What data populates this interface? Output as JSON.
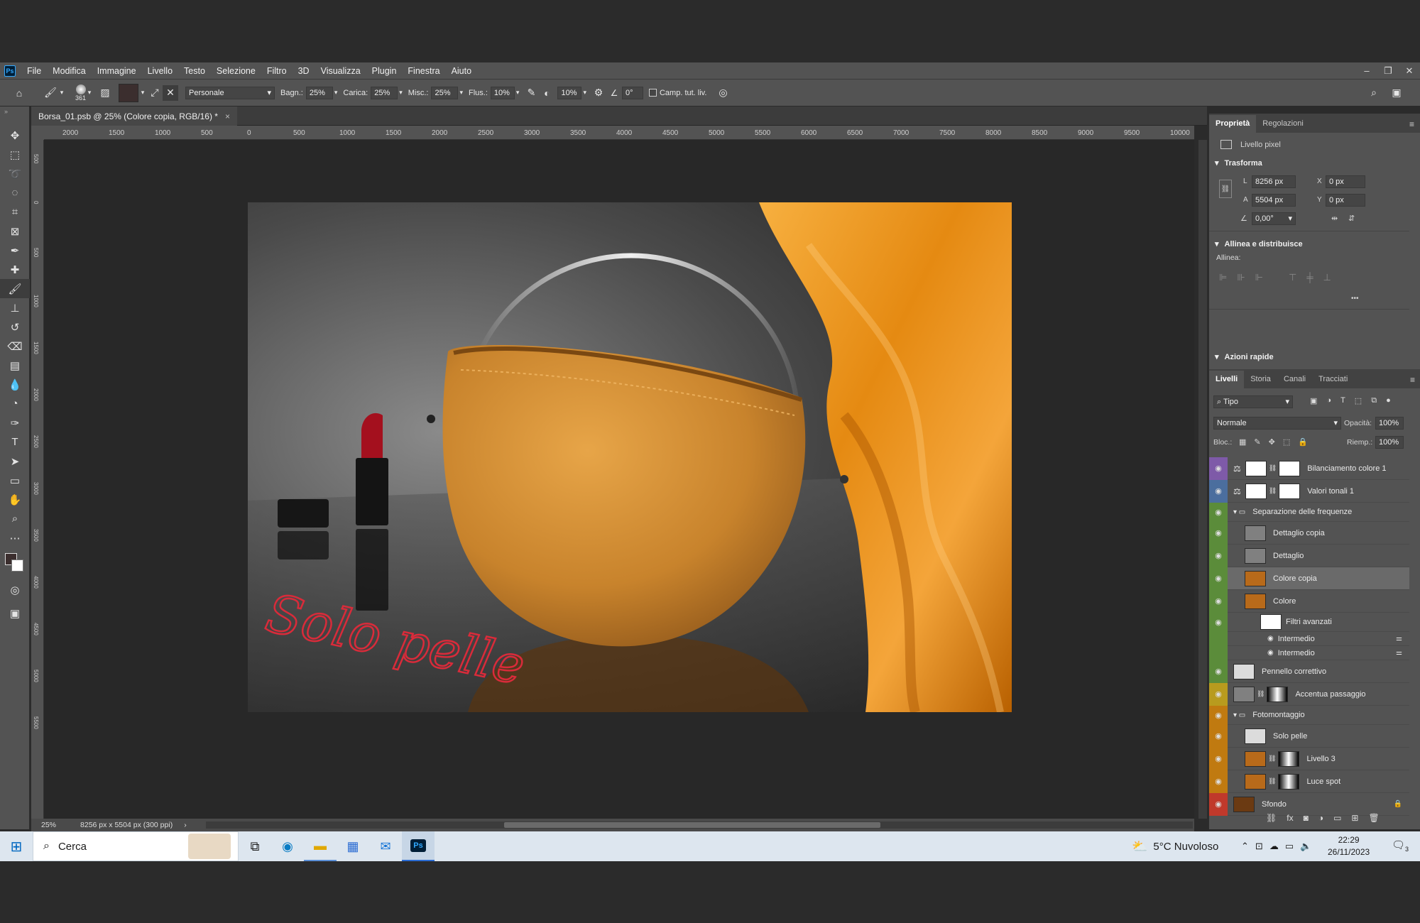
{
  "app": {
    "logo": "Ps"
  },
  "menu": [
    "File",
    "Modifica",
    "Immagine",
    "Livello",
    "Testo",
    "Selezione",
    "Filtro",
    "3D",
    "Visualizza",
    "Plugin",
    "Finestra",
    "Aiuto"
  ],
  "window_controls": {
    "minimize": "–",
    "restore": "❐",
    "close": "✕"
  },
  "options": {
    "brush_size": "361",
    "preset": "Personale",
    "bagn_label": "Bagn.:",
    "bagn": "25%",
    "carica_label": "Carica:",
    "carica": "25%",
    "misc_label": "Misc.:",
    "misc": "25%",
    "flus_label": "Flus.:",
    "flus": "10%",
    "pressure": "10%",
    "angle": "0°",
    "sample_label": "Camp. tut. liv."
  },
  "document": {
    "tab": "Borsa_01.psb @ 25% (Colore  copia, RGB/16) *",
    "close": "×"
  },
  "ruler": {
    "h_ticks": [
      "2000",
      "1500",
      "1000",
      "500",
      "0",
      "500",
      "1000",
      "1500",
      "2000",
      "2500",
      "3000",
      "3500",
      "4000",
      "4500",
      "5000",
      "5500",
      "6000",
      "6500",
      "7000",
      "7500",
      "8000",
      "8500",
      "9000",
      "9500",
      "10000"
    ],
    "v_ticks": [
      "500",
      "0",
      "500",
      "1000",
      "1500",
      "2000",
      "2500",
      "3000",
      "3500",
      "4000",
      "4500",
      "5000",
      "5500"
    ]
  },
  "photo": {
    "script_text": "Solo pelle"
  },
  "status": {
    "zoom": "25%",
    "size": "8256 px x 5504 px (300 ppi)",
    "arrow": "›"
  },
  "properties": {
    "tabs": [
      "Proprietà",
      "Regolazioni"
    ],
    "kind": "Livello pixel",
    "transform_title": "Trasforma",
    "w_label": "L",
    "w": "8256 px",
    "h_label": "A",
    "h": "5504 px",
    "x_label": "X",
    "x": "0 px",
    "y_label": "Y",
    "y": "0 px",
    "angle": "0,00°",
    "align_title": "Allinea e distribuisce",
    "align_label": "Allinea:",
    "more": "•••",
    "quick_title": "Azioni rapide"
  },
  "layers_panel": {
    "tabs": [
      "Livelli",
      "Storia",
      "Canali",
      "Tracciati"
    ],
    "filter": "Tipo",
    "blend": "Normale",
    "opacity_label": "Opacità:",
    "opacity": "100%",
    "lock_label": "Bloc.:",
    "fill_label": "Riemp.:",
    "fill": "100%",
    "layers": [
      {
        "name": "Bilanciamento colore 1",
        "color": "#7e5aa8",
        "thumb": "#ffffff",
        "indent": 0,
        "mask": true,
        "kind": "adj"
      },
      {
        "name": "Valori tonali 1",
        "color": "#4b6e9e",
        "thumb": "#ffffff",
        "indent": 0,
        "mask": true,
        "kind": "adj"
      },
      {
        "name": "Separazione delle frequenze",
        "color": "#5b8c3a",
        "indent": 0,
        "kind": "group"
      },
      {
        "name": "Dettaglio copia",
        "color": "#5b8c3a",
        "thumb": "#808080",
        "indent": 1,
        "kind": "pixel"
      },
      {
        "name": "Dettaglio",
        "color": "#5b8c3a",
        "thumb": "#808080",
        "indent": 1,
        "kind": "pixel"
      },
      {
        "name": "Colore  copia",
        "color": "#5b8c3a",
        "thumb": "#b86a1a",
        "indent": 1,
        "kind": "pixel",
        "selected": true
      },
      {
        "name": "Colore",
        "color": "#5b8c3a",
        "thumb": "#b86a1a",
        "indent": 1,
        "kind": "smart"
      },
      {
        "name": "Filtri avanzati",
        "color": "#5b8c3a",
        "thumb": "#ffffff",
        "indent": 2,
        "kind": "filter"
      },
      {
        "name": "Intermedio",
        "color": "#5b8c3a",
        "indent": 3,
        "kind": "sub"
      },
      {
        "name": "Intermedio",
        "color": "#5b8c3a",
        "indent": 3,
        "kind": "sub"
      },
      {
        "name": "Pennello correttivo",
        "color": "#5b8c3a",
        "thumb": "#dcdcdc",
        "indent": 0,
        "kind": "pixel"
      },
      {
        "name": "Accentua passaggio",
        "color": "#b89b1e",
        "thumb": "#808080",
        "indent": 0,
        "mask": true,
        "kind": "pixel"
      },
      {
        "name": "Fotomontaggio",
        "color": "#c07a10",
        "indent": 0,
        "kind": "group"
      },
      {
        "name": "Solo pelle",
        "color": "#c07a10",
        "thumb": "#dcdcdc",
        "indent": 1,
        "kind": "pixel"
      },
      {
        "name": "Livello 3",
        "color": "#c07a10",
        "thumb": "#b86a1a",
        "indent": 1,
        "mask": true,
        "kind": "pixel"
      },
      {
        "name": "Luce spot",
        "color": "#c07a10",
        "thumb": "#b86a1a",
        "indent": 1,
        "mask": true,
        "kind": "pixel"
      },
      {
        "name": "Sfondo",
        "color": "#c0392b",
        "thumb": "#6b3a12",
        "indent": 0,
        "kind": "bg"
      }
    ]
  },
  "taskbar": {
    "search": "Cerca",
    "weather": "5°C  Nuvoloso",
    "time": "22:29",
    "date": "26/11/2023",
    "notif": "3"
  }
}
